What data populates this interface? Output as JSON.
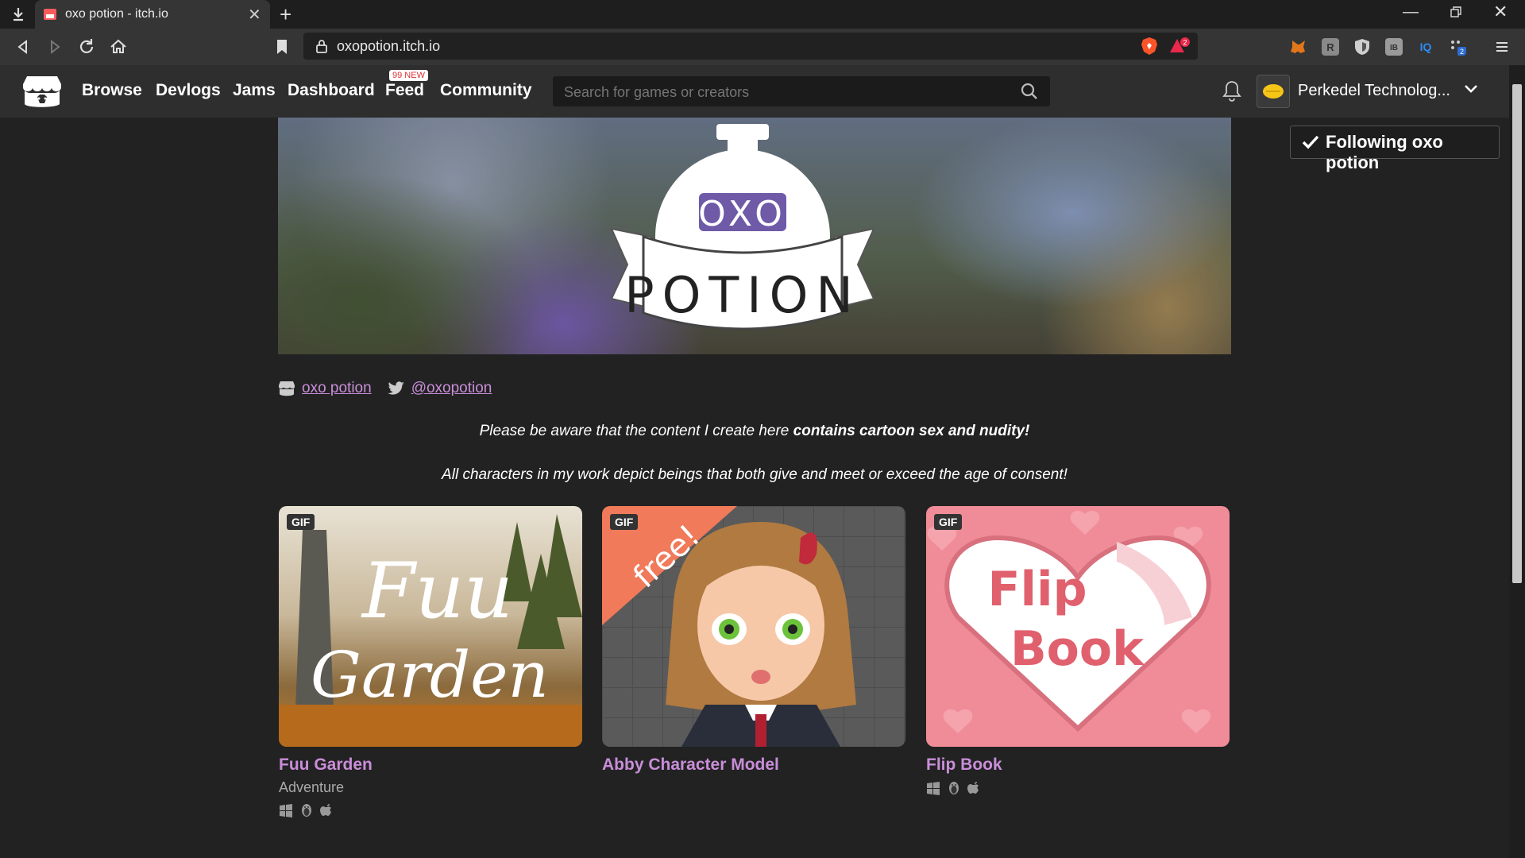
{
  "browser": {
    "tab_title": "oxo potion - itch.io",
    "url": "oxopotion.itch.io",
    "new_tab_symbol": "+",
    "rewards_count": "2",
    "ext_badge": "2"
  },
  "itch_nav": {
    "items": [
      "Browse",
      "Devlogs",
      "Jams",
      "Dashboard",
      "Feed",
      "Community"
    ],
    "feed_badge": "99 NEW",
    "search_placeholder": "Search for games or creators",
    "user_name": "Perkedel Technolog..."
  },
  "banner": {
    "logo_top": "OXO",
    "logo_bottom": "POTION"
  },
  "follow_button": {
    "label": "Following oxo potion"
  },
  "profile_links": {
    "itch_name": "oxo potion",
    "twitter_handle": "@oxopotion"
  },
  "notice": {
    "line1_prefix": "Please be aware that the content I create here ",
    "line1_bold": "contains cartoon sex and nudity!",
    "line2": "All characters in my work depict beings that both give and meet or exceed the age of consent!"
  },
  "games": [
    {
      "title": "Fuu Garden",
      "genre": "Adventure",
      "badge": "GIF",
      "thumb_text": [
        "Fuu",
        "Garden"
      ],
      "platforms": [
        "windows-icon",
        "linux-icon",
        "apple-icon"
      ]
    },
    {
      "title": "Abby Character Model",
      "genre": "",
      "badge": "GIF",
      "ribbon": "free!",
      "platforms": []
    },
    {
      "title": "Flip Book",
      "genre": "",
      "badge": "GIF",
      "thumb_text": [
        "Flip",
        "Book"
      ],
      "platforms": [
        "windows-icon",
        "linux-icon",
        "apple-icon"
      ]
    }
  ],
  "colors": {
    "page_bg": "#222222",
    "link": "#c98ed9",
    "header_bg": "#2e2e2e",
    "flip_book_pink": "#f08c98"
  }
}
